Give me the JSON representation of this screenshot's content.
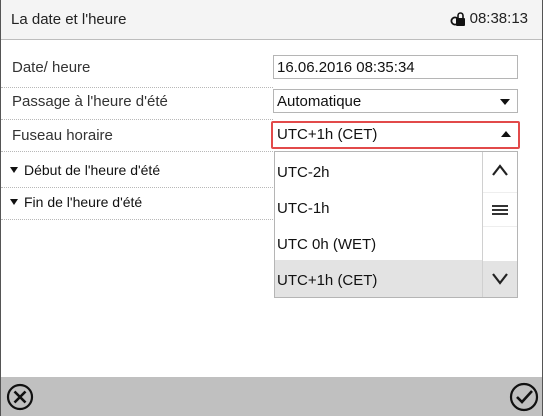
{
  "header": {
    "title": "La date et l'heure",
    "clock": "08:38:13",
    "lock_icon": "lock-icon"
  },
  "rows": {
    "date": {
      "label": "Date/ heure",
      "value": "16.06.2016 08:35:34"
    },
    "dst": {
      "label": "Passage à l'heure d'été",
      "value": "Automatique"
    },
    "timezone": {
      "label": "Fuseau horaire",
      "value": "UTC+1h (CET)"
    },
    "dst_start": {
      "label": "Début de l'heure d'été"
    },
    "dst_end": {
      "label": "Fin de l'heure d'été"
    }
  },
  "timezone_options": [
    {
      "label": "UTC-2h",
      "selected": false
    },
    {
      "label": "UTC-1h",
      "selected": false
    },
    {
      "label": "UTC 0h (WET)",
      "selected": false
    },
    {
      "label": "UTC+1h (CET)",
      "selected": true
    }
  ],
  "footer": {
    "cancel_icon": "cancel-circle-icon",
    "confirm_icon": "confirm-check-icon"
  },
  "colors": {
    "active_border": "#e24a4a",
    "footer_bg": "#c0c0c0",
    "selected_bg": "#e3e3e3"
  }
}
